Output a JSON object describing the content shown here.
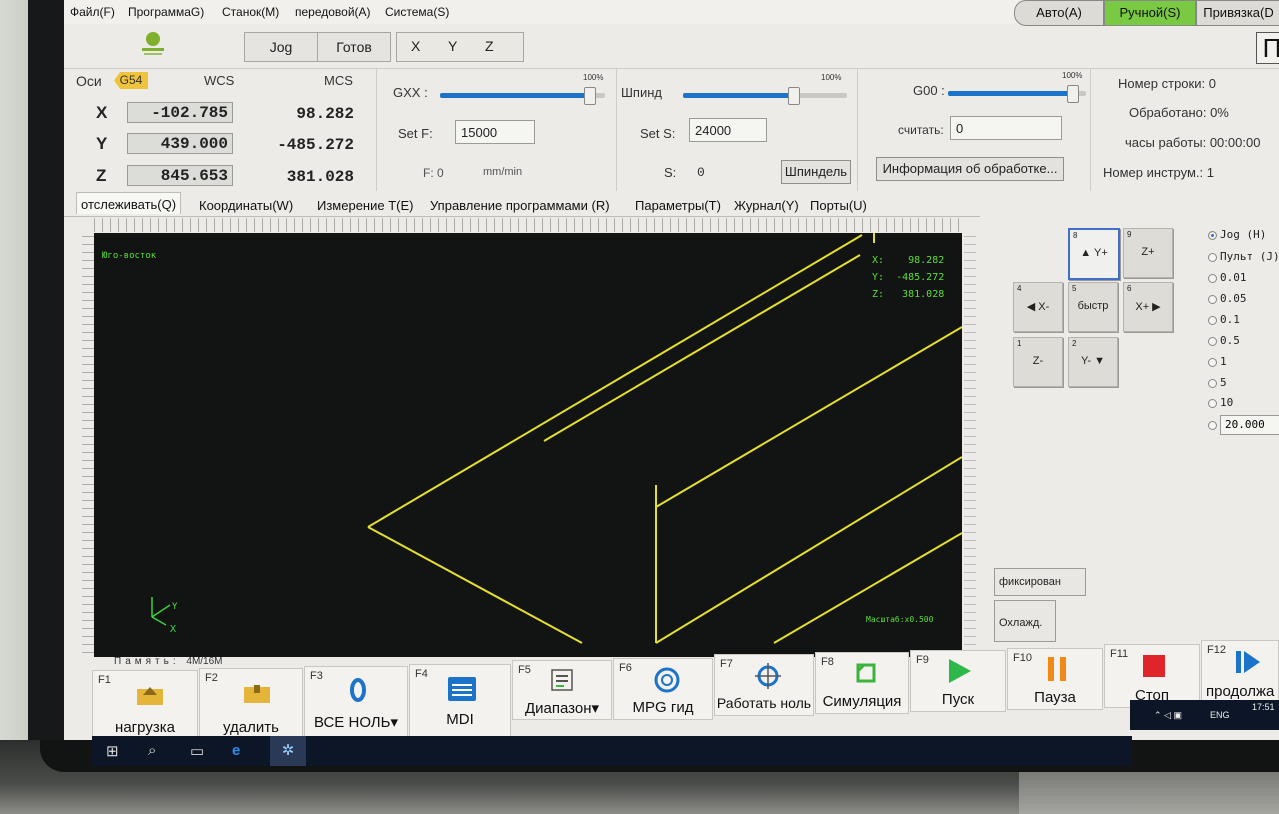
{
  "menu": [
    "Файл(F)",
    "ПрограммаG)",
    "Станок(M)",
    "передовой(A)",
    "Система(S)"
  ],
  "toolbar": {
    "jog": "Jog",
    "status": "Готов",
    "axis_x": "X",
    "axis_y": "Y",
    "axis_z": "Z",
    "right_btn": "П"
  },
  "dro": {
    "axes_label": "Оси",
    "cs": "G54",
    "wcs_label": "WCS",
    "mcs_label": "MCS",
    "x": {
      "name": "X",
      "wcs": "-102.785",
      "mcs": "98.282"
    },
    "y": {
      "name": "Y",
      "wcs": "439.000",
      "mcs": "-485.272"
    },
    "z": {
      "name": "Z",
      "wcs": "845.653",
      "mcs": "381.028"
    }
  },
  "feed": {
    "label": "GXX :",
    "pct_text": "100%",
    "override_fraction": 0.9,
    "setf_label": "Set F:",
    "setf_value": "15000",
    "f_text": "F: 0",
    "unit": "mm/min"
  },
  "spindle": {
    "label": "Шпинд",
    "pct_text": "100%",
    "override_fraction": 0.67,
    "sets_label": "Set S:",
    "sets_value": "24000",
    "s_label": "S:",
    "s_value": "0",
    "button": "Шпиндель"
  },
  "rapid": {
    "label": "G00 :",
    "pct_text": "100%",
    "override_fraction": 0.9,
    "read_label": "считать:",
    "read_value": "0",
    "info_button": "Информация об обработке..."
  },
  "info": {
    "line_no": "Номер строки: 0",
    "processed": "Обработано: 0%",
    "hours": "часы работы: 00:00:00",
    "tool": "Номер инструм.: 1"
  },
  "tabs": [
    "отслеживать(Q)",
    "Координаты(W)",
    "Измерение T(E)",
    "Управление программами (R)",
    "Параметры(T)",
    "Журнал(Y)",
    "Порты(U)"
  ],
  "viewport": {
    "view_name": "Юго-восток",
    "coord_x": "X:    98.282",
    "coord_y": "Y:  -485.272",
    "coord_z": "Z:   381.028",
    "scale": "Масштаб:x0.500",
    "triad_y": "Y",
    "triad_x": "X"
  },
  "memory": {
    "label": "Память:",
    "value": "4M/16M"
  },
  "modes": {
    "auto": "Авто(A)",
    "manual": "Ручной(S)",
    "bind": "Привязка(D"
  },
  "jog_keys": [
    {
      "n": "8",
      "label": "▲ Y+"
    },
    {
      "n": "9",
      "label": "Z+"
    },
    {
      "n": "4",
      "label": "◀ X-"
    },
    {
      "n": "5",
      "label": "быстр"
    },
    {
      "n": "6",
      "label": "X+ ▶"
    },
    {
      "n": "1",
      "label": "Z-"
    },
    {
      "n": "2",
      "label": "Y- ▼"
    }
  ],
  "step_options": [
    "Jog (H)",
    "Пульт (J)",
    "0.01",
    "0.05",
    "0.1",
    "0.5",
    "1",
    "5",
    "10"
  ],
  "step_custom": "20.000",
  "side_buttons": {
    "fixed": "фиксирован",
    "coolant": "Охлажд."
  },
  "fkeys": [
    {
      "k": "F1",
      "t": "нагрузка"
    },
    {
      "k": "F2",
      "t": "удалить"
    },
    {
      "k": "F3",
      "t": "ВСЕ НОЛЬ▾"
    },
    {
      "k": "F4",
      "t": "MDI"
    },
    {
      "k": "F5",
      "t": "Диапазон▾"
    },
    {
      "k": "F6",
      "t": "MPG гид"
    },
    {
      "k": "F7",
      "t": "Работать ноль"
    },
    {
      "k": "F8",
      "t": "Симуляция"
    },
    {
      "k": "F9",
      "t": "Пуск"
    },
    {
      "k": "F10",
      "t": "Пауза"
    },
    {
      "k": "F11",
      "t": "Стоп"
    },
    {
      "k": "F12",
      "t": "продолжа"
    }
  ],
  "tray": {
    "lang": "ENG",
    "time": "17:51"
  },
  "colors": {
    "accent": "#1b74c9",
    "g54": "#f0c43a",
    "viewport_bg": "#111412",
    "toolpath": "#e5e02a",
    "overlay_text": "#5dde3b",
    "manual_active": "#7ac943"
  }
}
